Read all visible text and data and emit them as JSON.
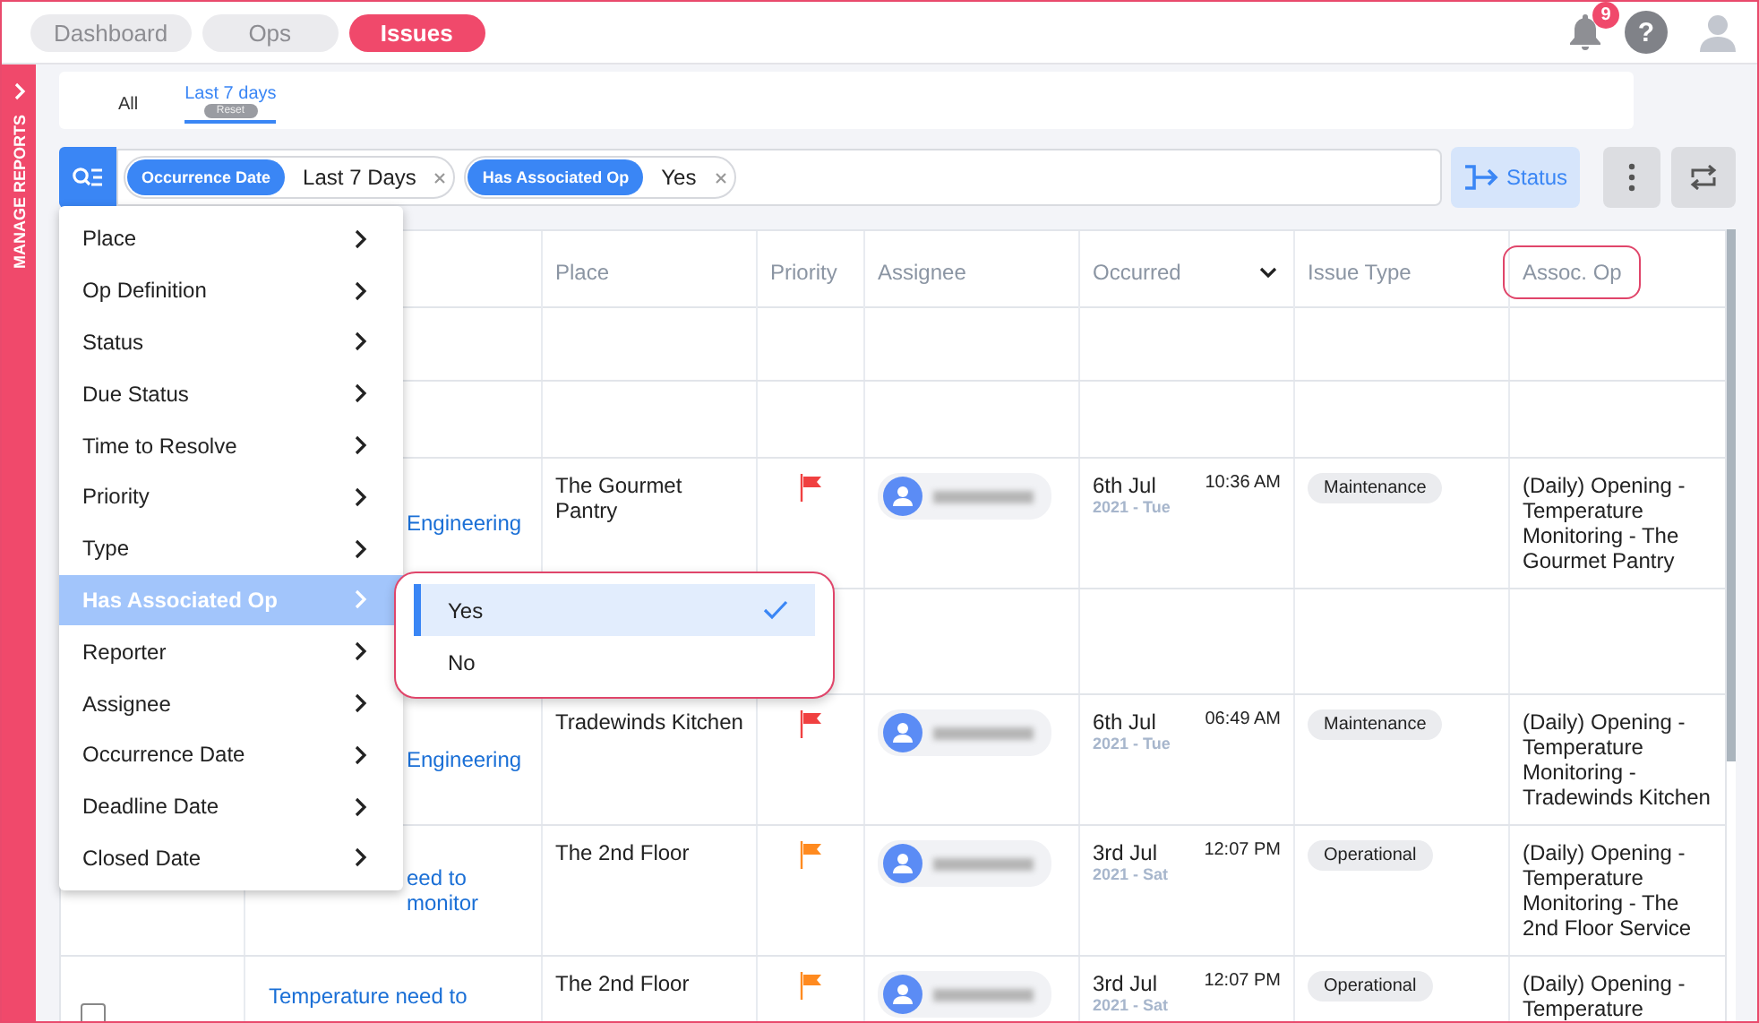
{
  "top_nav": {
    "tabs": [
      {
        "label": "Dashboard",
        "selected": false
      },
      {
        "label": "Ops",
        "selected": false
      },
      {
        "label": "Issues",
        "selected": true
      }
    ],
    "notification_count": "9",
    "help": "?"
  },
  "sidebar": {
    "label": "MANAGE REPORTS"
  },
  "date_tabs": [
    {
      "label": "All",
      "selected": false
    },
    {
      "label": "Last 7 days",
      "selected": true,
      "badge": "Reset"
    }
  ],
  "filters": {
    "chips": [
      {
        "field": "Occurrence Date",
        "value": "Last 7 Days"
      },
      {
        "field": "Has Associated Op",
        "value": "Yes"
      }
    ],
    "status_button": "Status"
  },
  "filter_menu": {
    "items": [
      {
        "label": "Place",
        "selected": false
      },
      {
        "label": "Op Definition",
        "selected": false
      },
      {
        "label": "Status",
        "selected": false
      },
      {
        "label": "Due Status",
        "selected": false
      },
      {
        "label": "Time to Resolve",
        "selected": false
      },
      {
        "label": "Priority",
        "selected": false
      },
      {
        "label": "Type",
        "selected": false
      },
      {
        "label": "Has Associated Op",
        "selected": true
      },
      {
        "label": "Reporter",
        "selected": false
      },
      {
        "label": "Assignee",
        "selected": false
      },
      {
        "label": "Occurrence Date",
        "selected": false
      },
      {
        "label": "Deadline Date",
        "selected": false
      },
      {
        "label": "Closed Date",
        "selected": false
      }
    ],
    "submenu": {
      "highlighted": true,
      "options": [
        {
          "label": "Yes",
          "selected": true
        },
        {
          "label": "No",
          "selected": false
        }
      ]
    }
  },
  "table": {
    "columns": [
      {
        "label": "Place",
        "highlighted": false
      },
      {
        "label": "Priority",
        "highlighted": false
      },
      {
        "label": "Assignee",
        "highlighted": false
      },
      {
        "label": "Occurred",
        "highlighted": false,
        "sortable": true
      },
      {
        "label": "Issue Type",
        "highlighted": false
      },
      {
        "label": "Assoc. Op",
        "highlighted": true
      }
    ],
    "rows": [
      {
        "kind": "blank"
      },
      {
        "kind": "blank"
      },
      {
        "kind": "issue",
        "covered": true,
        "checkbox": false,
        "title": "Engineering",
        "place": "The Gourmet Pantry",
        "color": "#f04040",
        "date": "6th Jul",
        "year_day": "2021 - Tue",
        "time": "10:36 AM",
        "issue_type": "Maintenance",
        "assoc_op": "(Daily) Opening - Temperature Monitoring - The Gourmet Pantry"
      },
      {
        "kind": "blank"
      },
      {
        "kind": "issue",
        "covered": true,
        "checkbox": false,
        "title": "Engineering",
        "place": "Tradewinds Kitchen",
        "color": "#f04040",
        "date": "6th Jul",
        "year_day": "2021 - Tue",
        "time": "06:49 AM",
        "issue_type": "Maintenance",
        "assoc_op": "(Daily) Opening - Temperature Monitoring - Tradewinds Kitchen"
      },
      {
        "kind": "issue",
        "covered": true,
        "checkbox": false,
        "title": "eed to monitor",
        "place": "The 2nd Floor",
        "color": "#ff8a1f",
        "date": "3rd Jul",
        "year_day": "2021 - Sat",
        "time": "12:07 PM",
        "issue_type": "Operational",
        "assoc_op": "(Daily) Opening - Temperature Monitoring - The 2nd Floor Service"
      },
      {
        "kind": "issue",
        "covered": false,
        "checkbox": true,
        "title": "Temperature need to",
        "place": "The 2nd Floor",
        "color": "#ff8a1f",
        "date": "3rd Jul",
        "year_day": "2021 - Sat",
        "time": "12:07 PM",
        "issue_type": "Operational",
        "assoc_op": "(Daily) Opening - Temperature"
      }
    ]
  }
}
